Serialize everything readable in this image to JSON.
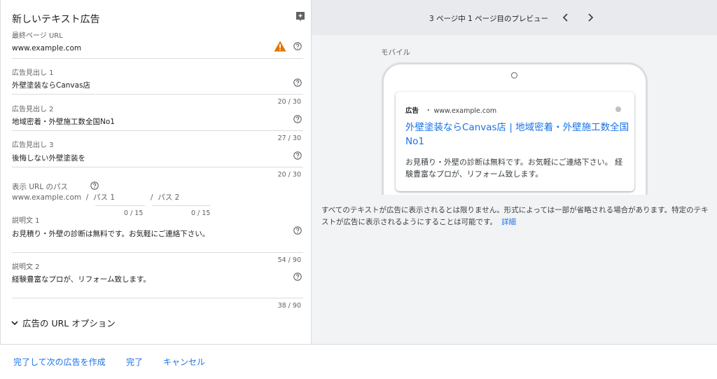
{
  "form": {
    "title": "新しいテキスト広告",
    "final_url": {
      "label": "最終ページ URL",
      "value": "www.example.com"
    },
    "headline1": {
      "label": "広告見出し 1",
      "value": "外壁塗装ならCanvas店",
      "count": "20 / 30"
    },
    "headline2": {
      "label": "広告見出し 2",
      "value": "地域密着・外壁施工数全国No1",
      "count": "27 / 30"
    },
    "headline3": {
      "label": "広告見出し 3",
      "value": "後悔しない外壁塗装を",
      "count": "20 / 30"
    },
    "display_path": {
      "label": "表示 URL のパス",
      "domain": "www.example.com",
      "path1_placeholder": "パス 1",
      "path2_placeholder": "パス 2",
      "path1_count": "0 / 15",
      "path2_count": "0 / 15"
    },
    "desc1": {
      "label": "説明文 1",
      "value": "お見積り・外壁の診断は無料です。お気軽にご連絡下さい。",
      "count": "54 / 90"
    },
    "desc2": {
      "label": "説明文 2",
      "value": "経験豊富なプロが、リフォーム致します。",
      "count": "38 / 90"
    },
    "url_options": "広告の URL オプション"
  },
  "actions": {
    "done_and_next": "完了して次の広告を作成",
    "done": "完了",
    "cancel": "キャンセル"
  },
  "preview": {
    "page_indicator": "3 ページ中 1 ページ目のプレビュー",
    "device_label": "モバイル",
    "ad_tag": "広告",
    "ad_url": "・ www.example.com",
    "headline": "外壁塗装ならCanvas店 | 地域密着・外壁施工数全国No1",
    "description": "お見積り・外壁の診断は無料です。お気軽にご連絡下さい。 経験豊富なプロが、リフォーム致します。",
    "note": "すべてのテキストが広告に表示されるとは限りません。形式によっては一部が省略される場合があります。特定のテキストが広告に表示されるようにすることは可能です。",
    "note_link": "詳細"
  },
  "icons": {
    "warning": "warning-icon",
    "help": "help-icon",
    "ai_sparkle": "sparkle-icon",
    "prev": "chevron-left-icon",
    "next": "chevron-right-icon",
    "expand": "chevron-down-icon"
  },
  "colors": {
    "link": "#1a73e8",
    "warning": "#e37400",
    "preview_bg": "#f1f3f4"
  }
}
